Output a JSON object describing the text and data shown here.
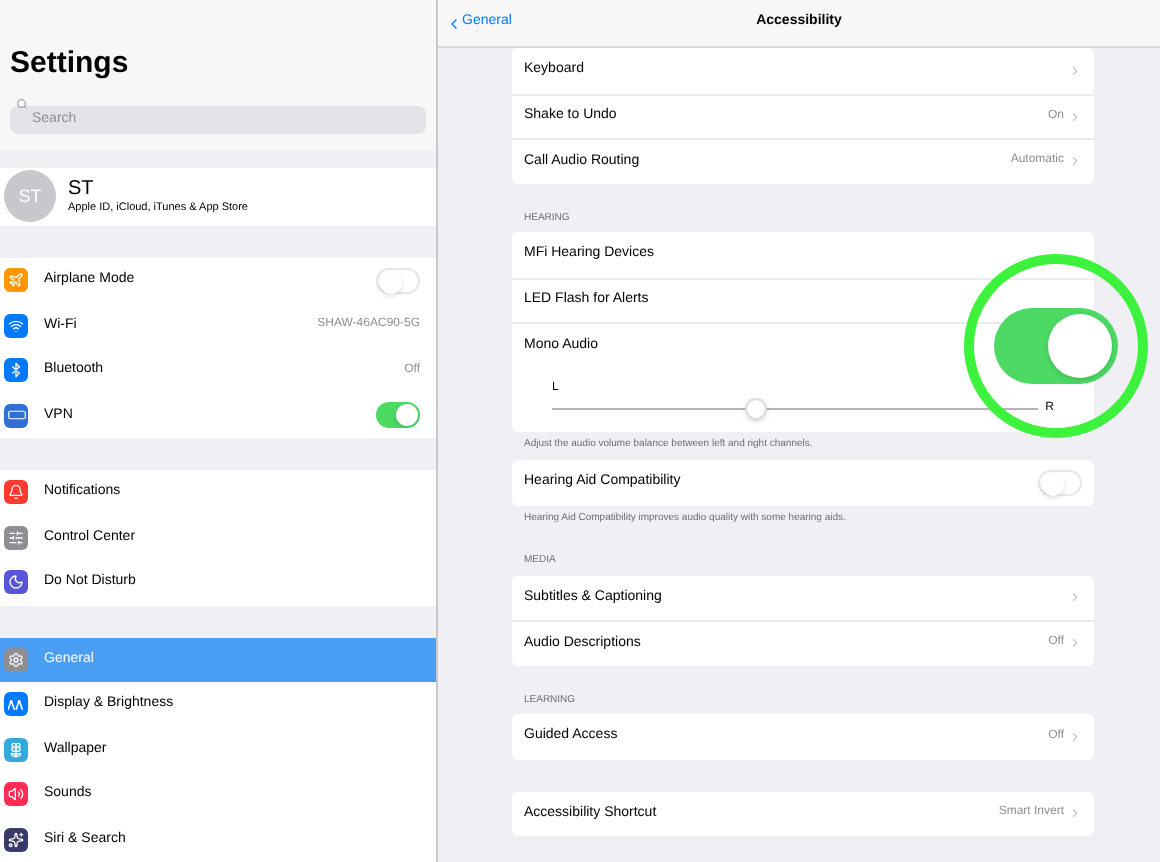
{
  "sidebar": {
    "title": "Settings",
    "search": {
      "placeholder": "Search"
    },
    "profile": {
      "initials": "ST",
      "name": "ST",
      "subtitle": "Apple ID, iCloud, iTunes & App Store"
    },
    "groups": [
      [
        {
          "label": "Airplane Mode",
          "kind": "toggle",
          "on": false,
          "color": "#ff9500",
          "selected": false
        },
        {
          "label": "Wi-Fi",
          "kind": "value",
          "value": "SHAW-46AC90-5G",
          "color": "#007aff",
          "selected": false
        },
        {
          "label": "Bluetooth",
          "kind": "value",
          "value": "Off",
          "color": "#007aff",
          "selected": false
        },
        {
          "label": "VPN",
          "kind": "toggle",
          "on": true,
          "color": "#2f6fd6",
          "selected": false
        }
      ],
      [
        {
          "label": "Notifications",
          "kind": "plain",
          "color": "#ff3b30",
          "selected": false
        },
        {
          "label": "Control Center",
          "kind": "plain",
          "color": "#8e8e93",
          "selected": false
        },
        {
          "label": "Do Not Disturb",
          "kind": "plain",
          "color": "#5856d6",
          "selected": false
        }
      ],
      [
        {
          "label": "General",
          "kind": "plain",
          "color": "#8e8e93",
          "selected": true
        },
        {
          "label": "Display & Brightness",
          "kind": "plain",
          "color": "#007aff",
          "selected": false
        },
        {
          "label": "Wallpaper",
          "kind": "plain",
          "color": "#34aadc",
          "selected": false
        },
        {
          "label": "Sounds",
          "kind": "plain",
          "color": "#ff2d55",
          "selected": false
        },
        {
          "label": "Siri & Search",
          "kind": "plain",
          "color": "#3a3a6a",
          "selected": false
        }
      ]
    ]
  },
  "detail": {
    "back": "General",
    "title": "Accessibility",
    "sections": [
      {
        "rows": [
          {
            "label": "Keyboard",
            "kind": "link"
          },
          {
            "label": "Shake to Undo",
            "kind": "link",
            "value": "On"
          },
          {
            "label": "Call Audio Routing",
            "kind": "link",
            "value": "Automatic"
          }
        ]
      },
      {
        "header": "HEARING",
        "rows": [
          {
            "label": "MFi Hearing Devices",
            "kind": "plain"
          },
          {
            "label": "LED Flash for Alerts",
            "kind": "plain"
          },
          {
            "label": "Mono Audio",
            "kind": "plain"
          },
          {
            "kind": "slider",
            "left": "L",
            "right": "R",
            "level": 0.42
          }
        ],
        "footer": "Adjust the audio volume balance between left and right channels."
      },
      {
        "rows": [
          {
            "label": "Hearing Aid Compatibility",
            "kind": "toggle",
            "on": false
          }
        ],
        "footer": "Hearing Aid Compatibility improves audio quality with some hearing aids."
      },
      {
        "header": "MEDIA",
        "rows": [
          {
            "label": "Subtitles & Captioning",
            "kind": "link"
          },
          {
            "label": "Audio Descriptions",
            "kind": "link",
            "value": "Off"
          }
        ]
      },
      {
        "header": "LEARNING",
        "rows": [
          {
            "label": "Guided Access",
            "kind": "link",
            "value": "Off"
          }
        ]
      },
      {
        "rows": [
          {
            "label": "Accessibility Shortcut",
            "kind": "link",
            "value": "Smart Invert"
          }
        ]
      }
    ]
  },
  "highlight": {
    "toggle_on": true
  }
}
